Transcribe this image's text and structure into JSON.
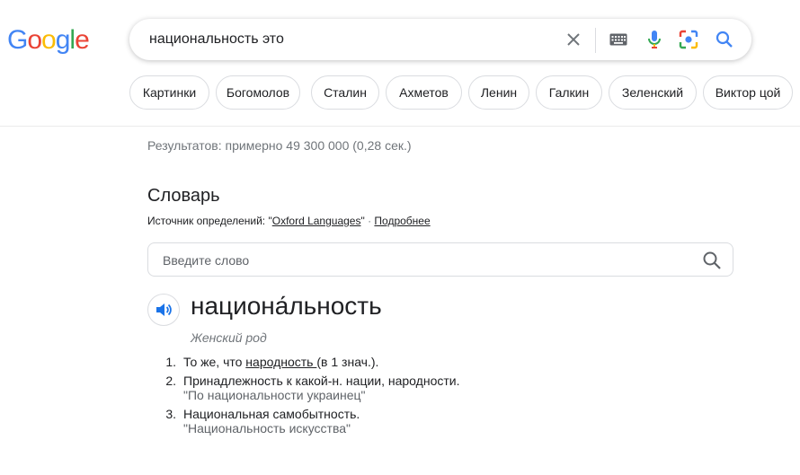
{
  "logo": {
    "letters": [
      "G",
      "o",
      "o",
      "g",
      "l",
      "e"
    ],
    "colors": [
      "#4285F4",
      "#EA4335",
      "#FBBC05",
      "#4285F4",
      "#34A853",
      "#EA4335"
    ]
  },
  "search": {
    "query": "национальность это"
  },
  "icons": {
    "clear": "close-icon",
    "keyboard": "keyboard-icon",
    "voice": "mic-icon",
    "lens": "lens-icon",
    "search": "search-icon"
  },
  "chips": [
    "Картинки",
    "Богомолов",
    "Сталин",
    "Ахметов",
    "Ленин",
    "Галкин",
    "Зеленский",
    "Виктор цой"
  ],
  "result_stats": "Результатов: примерно 49 300 000 (0,28 сек.)",
  "dictionary": {
    "title": "Словарь",
    "source_prefix": "Источник определений: \"",
    "source_link": "Oxford Languages",
    "source_suffix": "\"",
    "separator": " · ",
    "more_link": "Подробнее",
    "input_placeholder": "Введите слово",
    "headword": "национа́льность",
    "part_of_speech": "Женский род",
    "definitions": [
      {
        "num": "1.",
        "pre": "То же, что ",
        "link": "народность ",
        "post": "(в 1 знач.).",
        "example": ""
      },
      {
        "num": "2.",
        "pre": "Принадлежность к какой-н. нации, народности.",
        "link": "",
        "post": "",
        "example": "\"По национальности украинец\""
      },
      {
        "num": "3.",
        "pre": "Национальная самобытность.",
        "link": "",
        "post": "",
        "example": "\"Национальность искусства\""
      }
    ]
  }
}
